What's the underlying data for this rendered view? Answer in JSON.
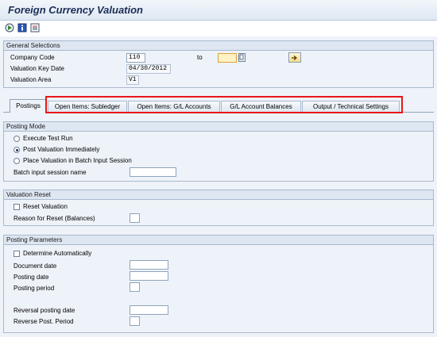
{
  "window": {
    "title": "Foreign Currency Valuation"
  },
  "toolbar": {
    "icons": [
      "execute-icon",
      "info-icon",
      "variant-list-icon"
    ]
  },
  "general_selections": {
    "title": "General Selections",
    "company_code_label": "Company Code",
    "company_code_value": "110",
    "to_label": "to",
    "to_value": "",
    "valuation_key_date_label": "Valuation Key Date",
    "valuation_key_date_value": "04/30/2012",
    "valuation_area_label": "Valuation Area",
    "valuation_area_value": "V1"
  },
  "tabs": [
    {
      "label": "Postings",
      "active": true
    },
    {
      "label": "Open Items: Subledger",
      "active": false
    },
    {
      "label": "Open Items: G/L Accounts",
      "active": false
    },
    {
      "label": "G/L Account Balances",
      "active": false
    },
    {
      "label": "Output / Technical Settings",
      "active": false
    }
  ],
  "posting_mode": {
    "title": "Posting Mode",
    "options": [
      {
        "label": "Execute Test Run",
        "selected": false
      },
      {
        "label": "Post Valuation Immediately",
        "selected": true
      },
      {
        "label": "Place Valuation in Batch Input Session",
        "selected": false
      }
    ],
    "batch_session_label": "Batch input session name",
    "batch_session_value": ""
  },
  "valuation_reset": {
    "title": "Valuation Reset",
    "reset_label": "Reset Valuation",
    "reset_checked": false,
    "reason_label": "Reason for Reset (Balances)",
    "reason_value": ""
  },
  "posting_parameters": {
    "title": "Posting Parameters",
    "determine_label": "Determine Automatically",
    "determine_checked": false,
    "document_date_label": "Document date",
    "posting_date_label": "Posting date",
    "posting_period_label": "Posting period",
    "reversal_posting_date_label": "Reversal posting date",
    "reverse_post_period_label": "Reverse Post. Period"
  },
  "colors": {
    "highlight": "#e8161b",
    "group_header": "#dde6f1",
    "panel": "#eef3f9"
  }
}
